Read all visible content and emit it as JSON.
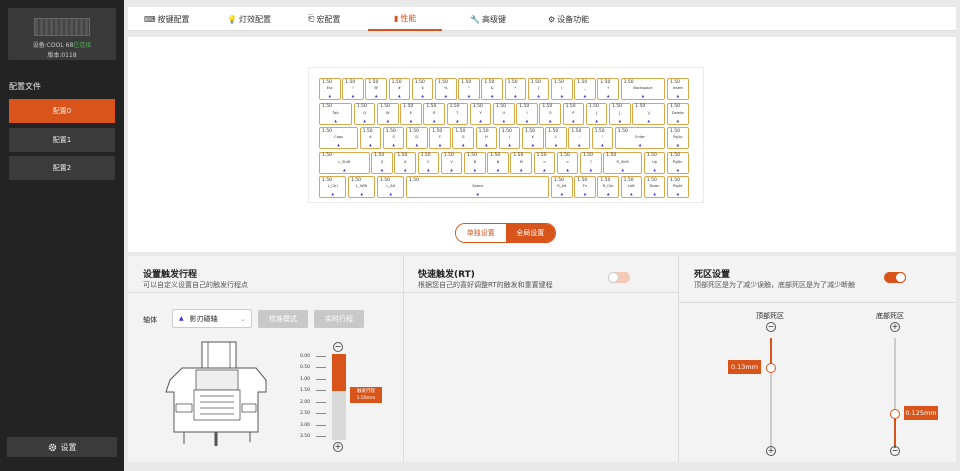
{
  "sidebar": {
    "device_name": "设备:COOL 68",
    "device_status": "已连接",
    "version": "版本:0118",
    "profiles_title": "配置文件",
    "profiles": [
      "配置0",
      "配置1",
      "配置2"
    ],
    "active_profile": 0,
    "settings_label": "设置"
  },
  "tabs": [
    {
      "label": "按键配置",
      "icon": "keyboard-icon"
    },
    {
      "label": "灯效配置",
      "icon": "bulb-icon"
    },
    {
      "label": "宏配置",
      "icon": "macro-icon"
    },
    {
      "label": "性能",
      "icon": "bar-chart-icon"
    },
    {
      "label": "高级键",
      "icon": "wrench-icon"
    },
    {
      "label": "设备功能",
      "icon": "gear-icon"
    }
  ],
  "active_tab": 3,
  "keyboard": {
    "value_label": "1.50",
    "rows": [
      [
        "Esc",
        "!",
        "@",
        "#",
        "$",
        "%",
        "^",
        "&",
        "*",
        "(",
        ")",
        "_",
        "+",
        "Backspace",
        "Insert"
      ],
      [
        "Tab",
        "Q",
        "W",
        "E",
        "R",
        "T",
        "Y",
        "U",
        "I",
        "O",
        "P",
        "{",
        "}",
        "\\|",
        "Delete"
      ],
      [
        "Caps",
        "A",
        "S",
        "D",
        "F",
        "G",
        "H",
        "J",
        "K",
        "L",
        ":",
        "\"",
        "Enter",
        "PgUp"
      ],
      [
        "L_Shift",
        "Z",
        "X",
        "C",
        "V",
        "B",
        "N",
        "M",
        "<",
        ">",
        "?",
        "R_Shift",
        "Up",
        "PgDn"
      ],
      [
        "L_Ctrl",
        "L_WIN",
        "L_Alt",
        "Space",
        "R_Alt",
        "Fn",
        "R_Ctrl",
        "Left",
        "Down",
        "Right"
      ]
    ]
  },
  "mode": {
    "single": "单独设置",
    "global": "全局设置"
  },
  "trigger": {
    "title": "设置触发行程",
    "desc": "可以自定义设置自己的触发行程点",
    "axis_label": "轴体",
    "axis_select": "影刃磁轴",
    "calibrate": "校准模式",
    "realtime": "实时行程",
    "scale": [
      "0.00",
      "0.50",
      "1.00",
      "1.50",
      "2.00",
      "2.50",
      "3.00",
      "3.50"
    ],
    "trigger_tag": "触发行程",
    "trigger_value": "1.50mm",
    "trigger_mm": 1.5,
    "max_mm": 3.5
  },
  "rt": {
    "title": "快速触发(RT)",
    "desc": "根据您自己的喜好调整RT的触发和重置键程",
    "enabled": false
  },
  "deadzone": {
    "title": "死区设置",
    "desc": "顶部死区是为了减少误触，底部死区是为了减少断触",
    "enabled": true,
    "top_label": "顶部死区",
    "bottom_label": "底部死区",
    "top_value": "0.13mm",
    "bottom_value": "0.125mm"
  },
  "colors": {
    "accent": "#d9541a",
    "key_border": "#d9a84a"
  }
}
